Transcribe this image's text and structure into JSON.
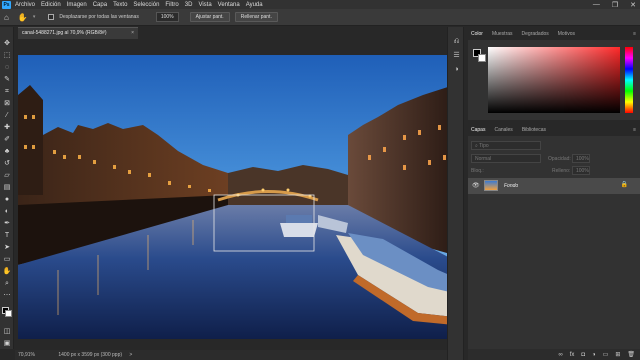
{
  "menubar": {
    "app_logo": "Ps",
    "items": [
      "Archivo",
      "Edición",
      "Imagen",
      "Capa",
      "Texto",
      "Selección",
      "Filtro",
      "3D",
      "Vista",
      "Ventana",
      "Ayuda"
    ],
    "window_controls": [
      "—",
      "❐",
      "✕"
    ]
  },
  "options": {
    "tool_icon": "hand-icon",
    "scroll_all_label": "Desplazarse por todas las ventanas",
    "zoom_value": "100%",
    "fit_button": "Ajustar pant.",
    "fill_button": "Rellenar pant."
  },
  "document": {
    "tab_title": "canal-5488271.jpg al 70,9% (RGB/8#)",
    "close": "×"
  },
  "status": {
    "zoom": "70,91%",
    "dimensions": "1400 px x 3599 px (300 ppp)",
    "arrow": ">"
  },
  "color_panel": {
    "tabs": [
      "Color",
      "Muestras",
      "Degradados",
      "Motivos"
    ],
    "active": "Color",
    "hue_color": "#ff2a2a"
  },
  "layers_panel": {
    "tabs": [
      "Capas",
      "Canales",
      "Bibliotecas"
    ],
    "active": "Capas",
    "search_placeholder": "Tipo",
    "blend_mode": "Normal",
    "opacity_label": "Opacidad:",
    "opacity_value": "100%",
    "lock_label": "Bloq.:",
    "fill_label": "Relleno:",
    "fill_value": "100%",
    "layer_name": "Fondo"
  }
}
